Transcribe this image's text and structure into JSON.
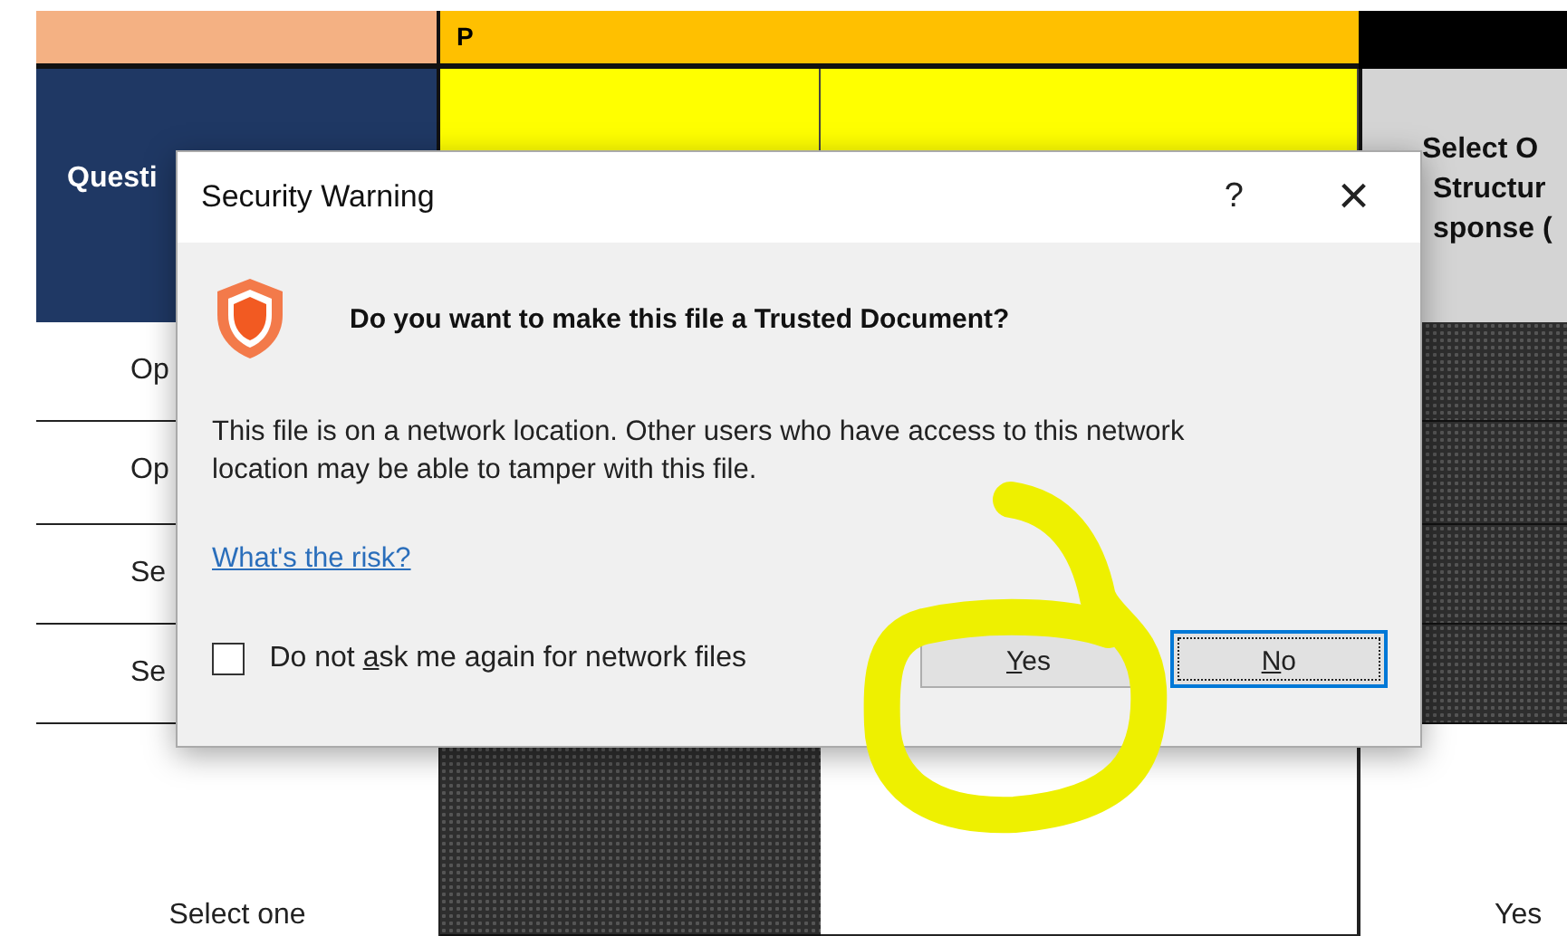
{
  "sheet": {
    "group_header": "P",
    "column_a_header": "Questi",
    "column_d_header": [
      "Select O",
      "Structur",
      "sponse ("
    ],
    "rows": [
      {
        "column_a": "Op"
      },
      {
        "column_a": "Op"
      },
      {
        "column_a": "Se"
      },
      {
        "column_a": "Se"
      },
      {
        "column_a": "Select one",
        "column_d": "Yes"
      }
    ]
  },
  "dialog": {
    "title": "Security Warning",
    "help": "?",
    "close": "×",
    "heading": "Do you want to make this file a Trusted Document?",
    "message": "This file is on a network location. Other users who have access to this network location may be able to tamper with this file.",
    "link": "What's the risk?",
    "checkbox": {
      "label_before": "Do not ",
      "label_key": "a",
      "label_after": "sk me again for network files",
      "checked": false
    },
    "buttons": [
      {
        "key": "Y",
        "after": "es",
        "focused": false
      },
      {
        "key": "N",
        "after": "o",
        "focused": true
      }
    ]
  }
}
